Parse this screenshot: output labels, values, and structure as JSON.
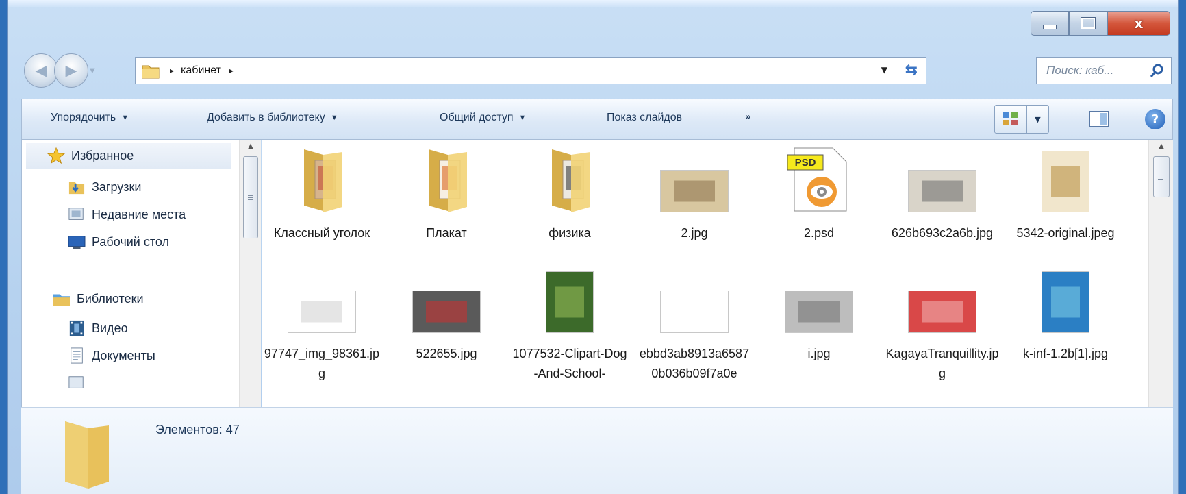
{
  "window": {
    "caption_buttons": {
      "minimize_icon": "minimize-icon",
      "maximize_icon": "maximize-icon",
      "close_label": "x"
    }
  },
  "navigation": {
    "back_icon": "back-arrow-icon",
    "forward_icon": "forward-arrow-icon",
    "address": {
      "current": "кабинет",
      "separator": "▸"
    },
    "search_placeholder": "Поиск: каб..."
  },
  "toolbar": {
    "organize": "Упорядочить",
    "add_to_library": "Добавить в библиотеку",
    "share": "Общий доступ",
    "slideshow": "Показ слайдов",
    "more": "»",
    "help": "?"
  },
  "nav_pane": {
    "favorites": "Избранное",
    "downloads": "Загрузки",
    "recent": "Недавние места",
    "desktop": "Рабочий стол",
    "libraries": "Библиотеки",
    "video": "Видео",
    "documents": "Документы"
  },
  "files": [
    {
      "label": "Классный уголок",
      "kind": "folder"
    },
    {
      "label": "Плакат",
      "kind": "folder"
    },
    {
      "label": "физика",
      "kind": "folder"
    },
    {
      "label": "2.jpg",
      "kind": "image"
    },
    {
      "label": "2.psd",
      "kind": "psd",
      "badge": "PSD"
    },
    {
      "label": "626b693c2a6b.jpg",
      "kind": "image"
    },
    {
      "label": "5342-original.jpeg",
      "kind": "image"
    },
    {
      "label": "97747_img_98361.jpg",
      "kind": "image"
    },
    {
      "label": "522655.jpg",
      "kind": "image"
    },
    {
      "label": "1077532-Clipart-Dog-And-School-",
      "kind": "image"
    },
    {
      "label": "ebbd3ab8913a65870b036b09f7a0e",
      "kind": "image"
    },
    {
      "label": "i.jpg",
      "kind": "image"
    },
    {
      "label": "KagayaTranquillity.jpg",
      "kind": "image"
    },
    {
      "label": "k-inf-1.2b[1].jpg",
      "kind": "image"
    }
  ],
  "details": {
    "count_text": "Элементов: 47"
  },
  "colors": {
    "accent": "#3b74c4",
    "close": "#d4573c",
    "folder": "#f2d375"
  }
}
